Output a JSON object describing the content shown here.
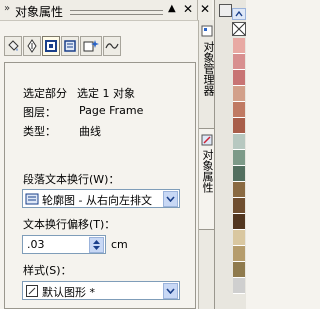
{
  "docker": {
    "title": "对象属性",
    "grip_icon": "double-chevron-right-icon",
    "collapse_icon": "triangle-up-icon",
    "close_icon": "close-icon"
  },
  "tabs": [
    {
      "name": "fill-tab",
      "icon": "fill-bucket-icon"
    },
    {
      "name": "outline-tab",
      "icon": "pen-nib-icon"
    },
    {
      "name": "text-wrap-tab",
      "icon": "frame-icon"
    },
    {
      "name": "paragraph-frame-tab",
      "icon": "frame-icon"
    },
    {
      "name": "effects-tab",
      "icon": "sparkle-icon"
    },
    {
      "name": "curve-tab",
      "icon": "wave-icon"
    }
  ],
  "info": {
    "selection_label": "选定部分",
    "selection_value": "选定 1 对象",
    "layer_label": "图层：",
    "layer_value": "Page Frame",
    "type_label": "类型：",
    "type_value": "曲线"
  },
  "wrap": {
    "label": "段落文本换行(W)：",
    "selected": "轮廓图 - 从右向左排文"
  },
  "offset": {
    "label": "文本换行偏移(T)：",
    "value": ".03",
    "unit": "cm"
  },
  "style": {
    "label": "样式(S)：",
    "selected": "默认图形 *"
  },
  "side_tabs": {
    "object_manager": "对象管理器",
    "object_properties": "对象属性"
  },
  "colors": {
    "swatches": [
      "#e8a9a3",
      "#d88f8f",
      "#c87474",
      "#d2a08a",
      "#c07a63",
      "#a85e4a",
      "#b7c8c0",
      "#7d9a88",
      "#536f5f",
      "#8a6a42",
      "#6f4e2f",
      "#52361f",
      "#d9c7a0",
      "#b59c6c",
      "#8f7a4d",
      "#cfcfcf"
    ]
  }
}
